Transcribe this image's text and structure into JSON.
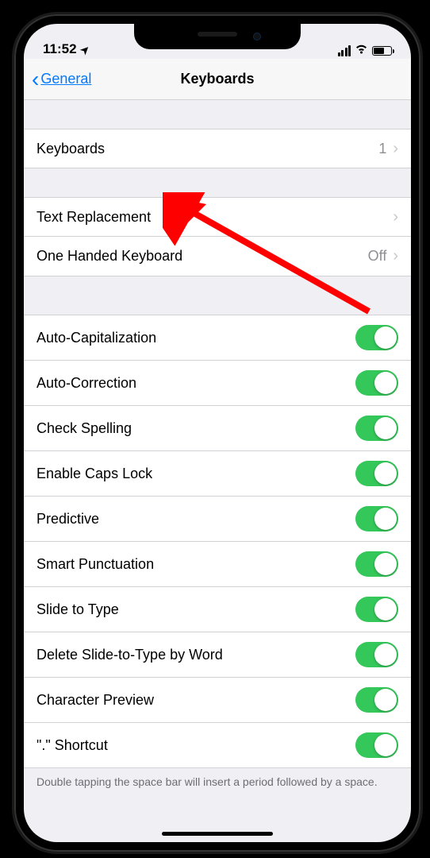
{
  "status": {
    "time": "11:52"
  },
  "nav": {
    "back_label": "General",
    "title": "Keyboards"
  },
  "sections": {
    "keyboards": {
      "label": "Keyboards",
      "value": "1"
    },
    "text_replacement": {
      "label": "Text Replacement"
    },
    "one_handed": {
      "label": "One Handed Keyboard",
      "value": "Off"
    }
  },
  "toggles": [
    {
      "label": "Auto-Capitalization",
      "on": true
    },
    {
      "label": "Auto-Correction",
      "on": true
    },
    {
      "label": "Check Spelling",
      "on": true
    },
    {
      "label": "Enable Caps Lock",
      "on": true
    },
    {
      "label": "Predictive",
      "on": true
    },
    {
      "label": "Smart Punctuation",
      "on": true
    },
    {
      "label": "Slide to Type",
      "on": true
    },
    {
      "label": "Delete Slide-to-Type by Word",
      "on": true
    },
    {
      "label": "Character Preview",
      "on": true
    },
    {
      "label": "\".\" Shortcut",
      "on": true
    }
  ],
  "footer": "Double tapping the space bar will insert a period followed by a space.",
  "colors": {
    "accent": "#007aff",
    "toggle_on": "#34c759",
    "annotation_arrow": "#ff0000"
  }
}
